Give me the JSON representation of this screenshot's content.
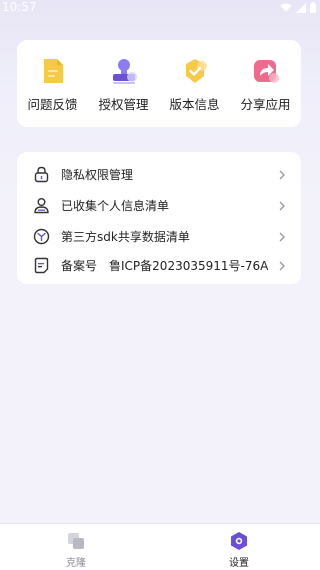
{
  "status_bar": {
    "time": "10:57"
  },
  "grid": {
    "items": [
      {
        "label": "问题反馈",
        "icon": "feedback-doc-icon"
      },
      {
        "label": "授权管理",
        "icon": "stamp-icon"
      },
      {
        "label": "版本信息",
        "icon": "verified-badge-icon"
      },
      {
        "label": "分享应用",
        "icon": "share-arrow-icon"
      }
    ]
  },
  "list": {
    "items": [
      {
        "label": "隐私权限管理",
        "icon": "lock-icon"
      },
      {
        "label": "已收集个人信息清单",
        "icon": "person-icon"
      },
      {
        "label": "第三方sdk共享数据清单",
        "icon": "third-party-icon"
      },
      {
        "label": "备案号",
        "value": "鲁ICP备2023035911号-76A",
        "icon": "record-doc-icon"
      }
    ]
  },
  "bottom_nav": {
    "items": [
      {
        "label": "克隆",
        "icon": "clone-icon",
        "active": false
      },
      {
        "label": "设置",
        "icon": "settings-hex-icon",
        "active": true
      }
    ]
  },
  "colors": {
    "accent": "#6b4fd6",
    "background": "#f3f2fa",
    "card": "#ffffff",
    "feedback": "#f7c948",
    "share": "#ef6b8e"
  }
}
